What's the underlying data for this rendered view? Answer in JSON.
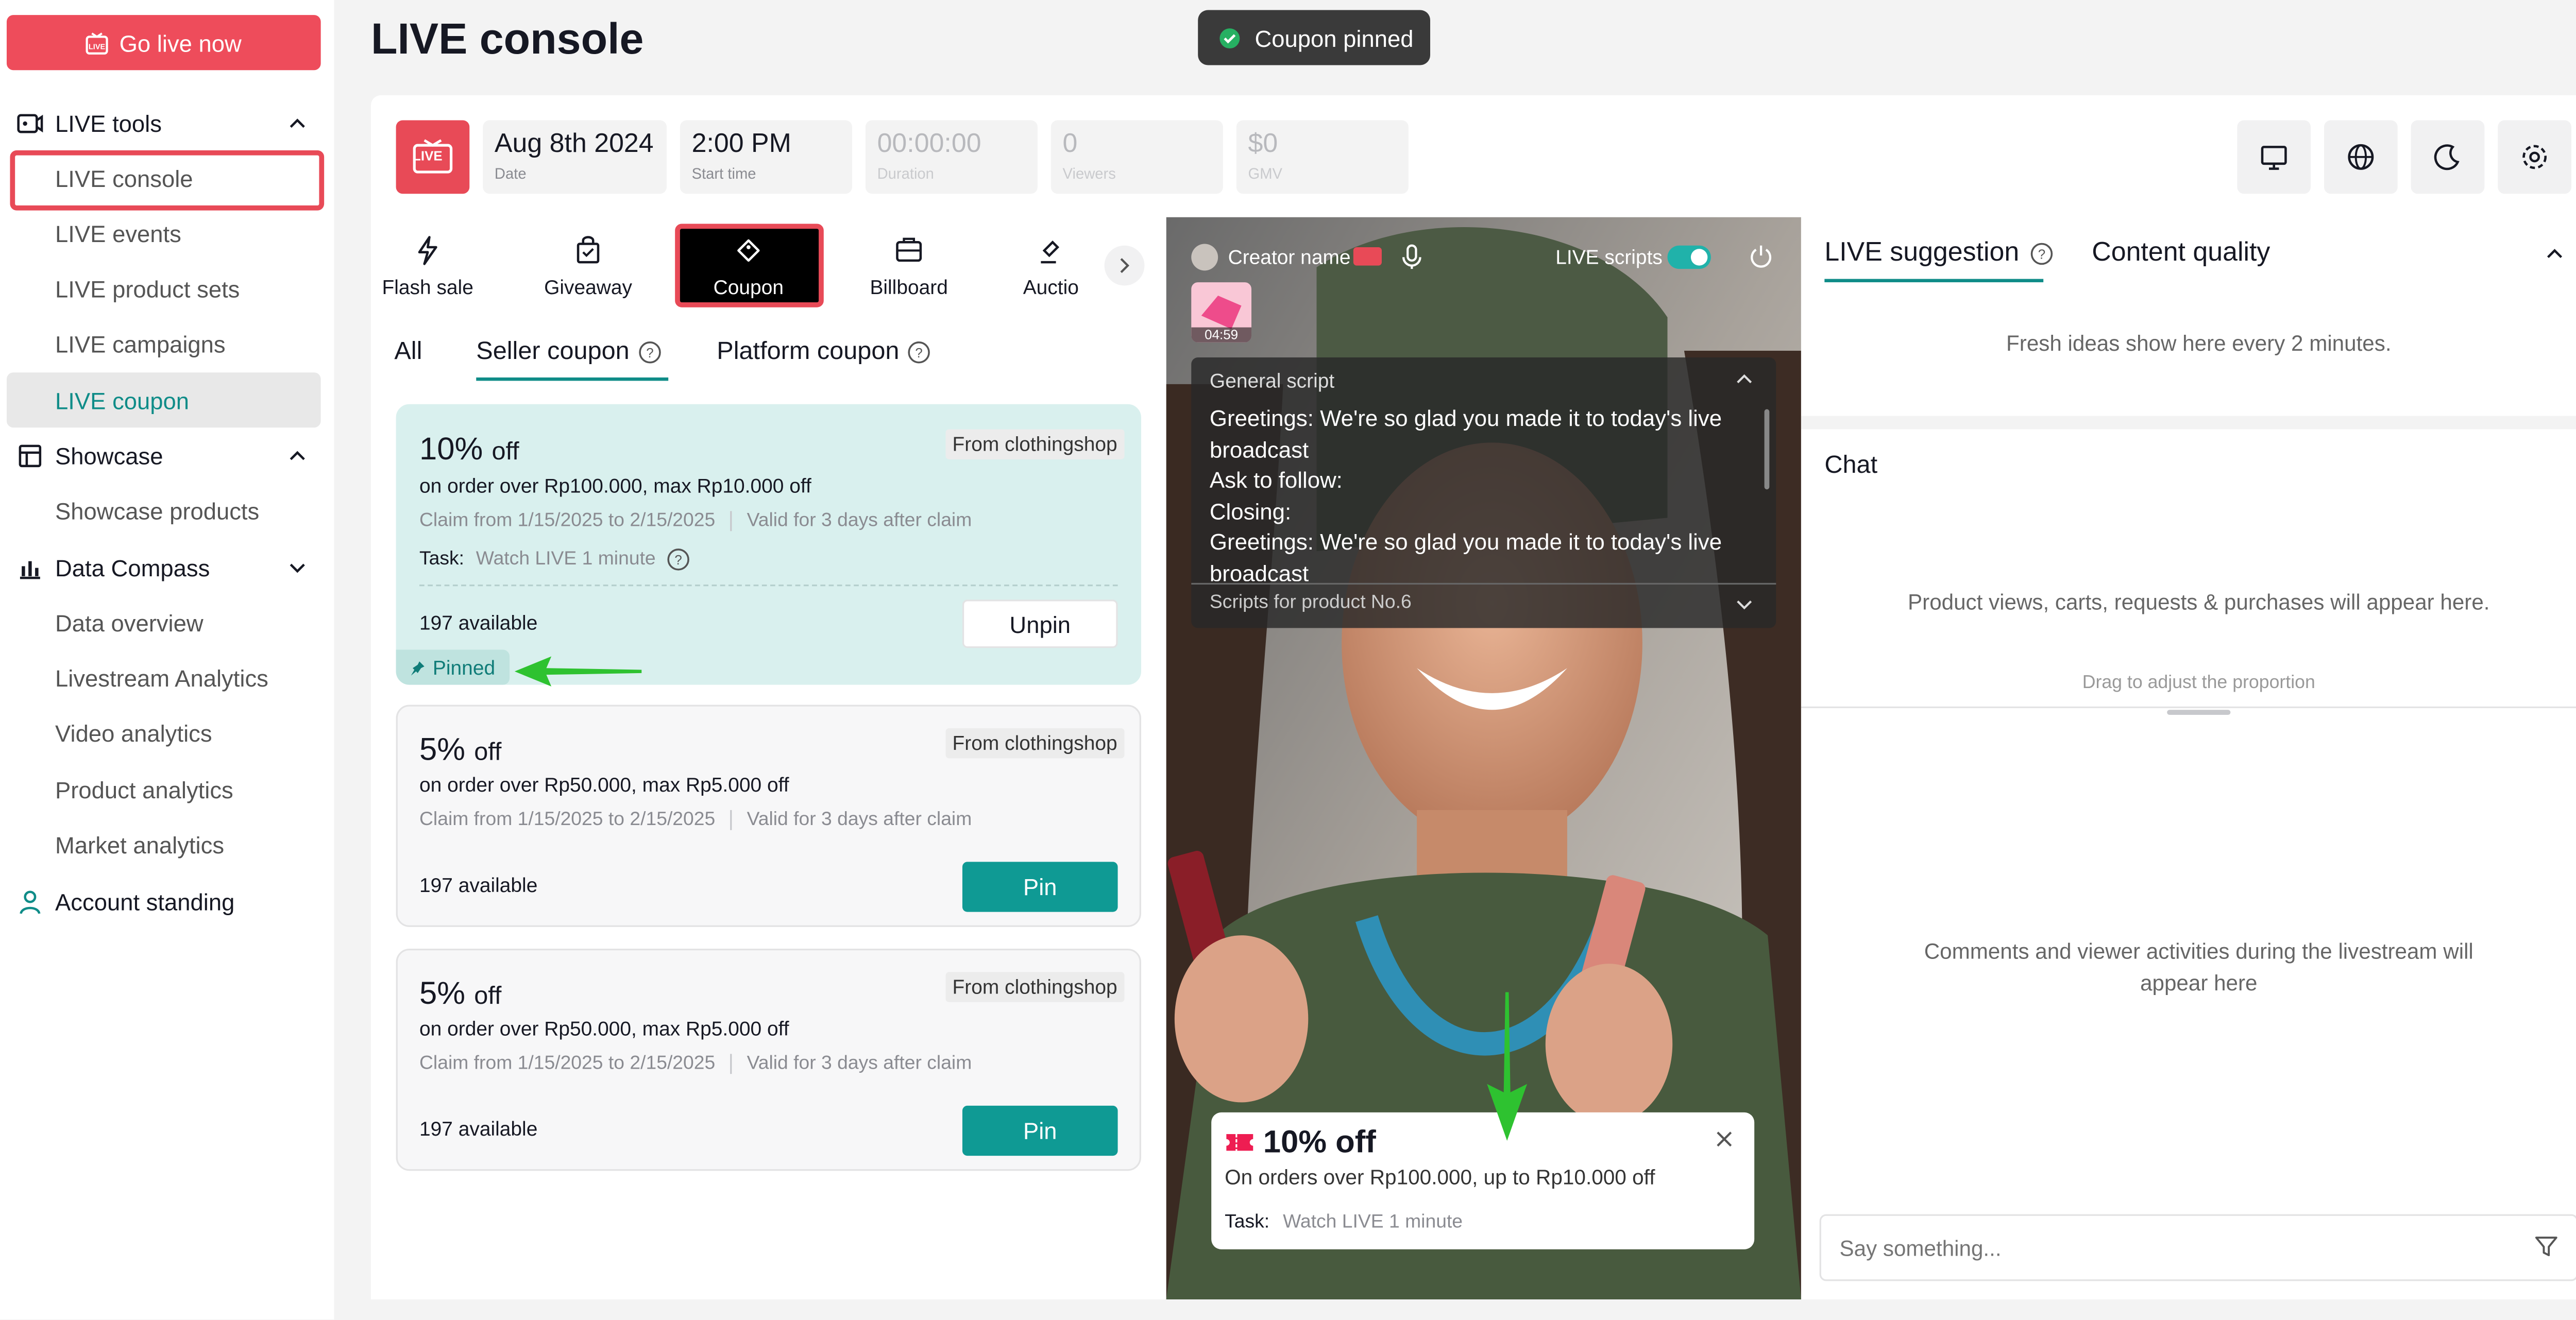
{
  "sidebar": {
    "go_live": "Go live now",
    "sections": {
      "live_tools": "LIVE tools",
      "showcase": "Showcase",
      "data_compass": "Data Compass",
      "account_standing": "Account standing"
    },
    "live_items": [
      "LIVE console",
      "LIVE events",
      "LIVE product sets",
      "LIVE campaigns",
      "LIVE coupon"
    ],
    "showcase_items": [
      "Showcase products"
    ],
    "data_items": [
      "Data overview",
      "Livestream Analytics",
      "Video analytics",
      "Product analytics",
      "Market analytics"
    ]
  },
  "header": {
    "title": "LIVE console",
    "toast": "Coupon pinned"
  },
  "topbar": {
    "live_badge": "LIVE",
    "stats": [
      {
        "value": "Aug 8th 2024",
        "label": "Date"
      },
      {
        "value": "2:00 PM",
        "label": "Start time"
      },
      {
        "value": "00:00:00",
        "label": "Duration"
      },
      {
        "value": "0",
        "label": "Viewers"
      },
      {
        "value": "$0",
        "label": "GMV"
      }
    ]
  },
  "tools": [
    "Flash sale",
    "Giveaway",
    "Coupon",
    "Billboard",
    "Auctio"
  ],
  "coupon_tabs": {
    "all": "All",
    "seller": "Seller coupon",
    "platform": "Platform coupon"
  },
  "coupons": [
    {
      "percent": "10%",
      "off": "off",
      "source": "From clothingshop",
      "condition": "on order over Rp100.000, max Rp10.000 off",
      "claim": "Claim from 1/15/2025 to 2/15/2025",
      "valid": "Valid for 3 days after claim",
      "task_label": "Task:",
      "task": "Watch LIVE 1 minute",
      "available": "197 available",
      "action": "Unpin",
      "tag": "Pinned"
    },
    {
      "percent": "5%",
      "off": "off",
      "source": "From clothingshop",
      "condition": "on order over Rp50.000, max Rp5.000 off",
      "claim": "Claim from 1/15/2025 to 2/15/2025",
      "valid": "Valid for 3 days after claim",
      "available": "197 available",
      "action": "Pin"
    },
    {
      "percent": "5%",
      "off": "off",
      "source": "From clothingshop",
      "condition": "on order over Rp50.000, max Rp5.000 off",
      "claim": "Claim from 1/15/2025 to 2/15/2025",
      "valid": "Valid for 3 days after claim",
      "available": "197 available",
      "action": "Pin"
    }
  ],
  "video": {
    "creator": "Creator name",
    "live_scripts": "LIVE scripts",
    "timer": "04:59",
    "script_title": "General script",
    "script_lines": [
      "Greetings: We're so glad you made it to today's live broadcast",
      "Ask to follow:",
      "Closing:",
      "Greetings: We're so glad you made it to today's live broadcast"
    ],
    "script_footer": "Scripts for product No.6",
    "overlay": {
      "title": "10% off",
      "desc": "On orders over Rp100.000, up to Rp10.000 off",
      "task_label": "Task:",
      "task": "Watch LIVE 1 minute"
    }
  },
  "right": {
    "tab_suggestion": "LIVE suggestion",
    "tab_quality": "Content quality",
    "suggestion_text": "Fresh ideas show here every 2 minutes.",
    "chat_title": "Chat",
    "chat_hint": "Product views, carts, requests & purchases will appear here.",
    "drag_hint": "Drag to adjust the proportion",
    "comments_hint": "Comments and viewer activities during the livestream will appear here",
    "chat_placeholder": "Say something..."
  }
}
